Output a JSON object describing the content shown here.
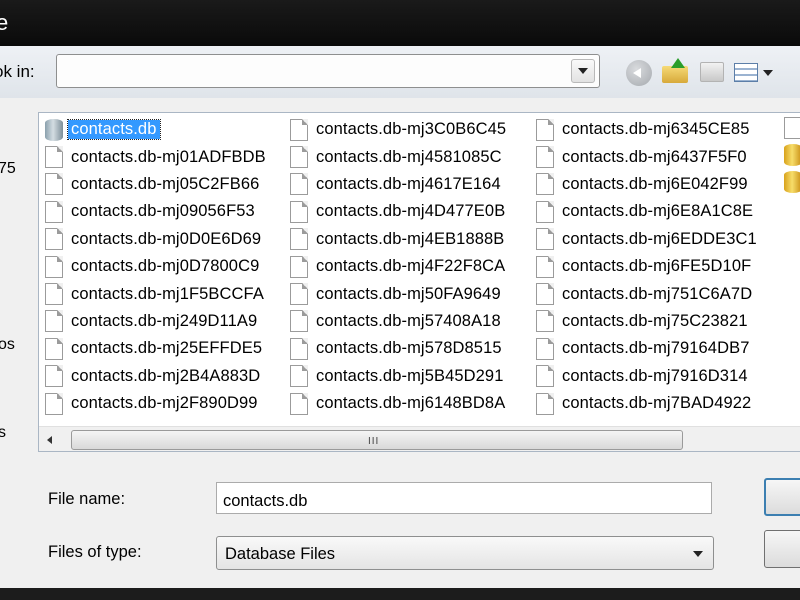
{
  "window": {
    "title_fragment": "e"
  },
  "look_in": {
    "label": "ok in:",
    "value": ""
  },
  "places_fragments": [
    "75",
    "os",
    "s"
  ],
  "files": {
    "columns": [
      [
        {
          "name": "contacts.db",
          "icon": "database",
          "selected": true
        },
        {
          "name": "contacts.db-mj01ADFBDB"
        },
        {
          "name": "contacts.db-mj05C2FB66"
        },
        {
          "name": "contacts.db-mj09056F53"
        },
        {
          "name": "contacts.db-mj0D0E6D69"
        },
        {
          "name": "contacts.db-mj0D7800C9"
        },
        {
          "name": "contacts.db-mj1F5BCCFA"
        },
        {
          "name": "contacts.db-mj249D11A9"
        },
        {
          "name": "contacts.db-mj25EFFDE5"
        },
        {
          "name": "contacts.db-mj2B4A883D"
        },
        {
          "name": "contacts.db-mj2F890D99"
        }
      ],
      [
        {
          "name": "contacts.db-mj3C0B6C45"
        },
        {
          "name": "contacts.db-mj4581085C"
        },
        {
          "name": "contacts.db-mj4617E164"
        },
        {
          "name": "contacts.db-mj4D477E0B"
        },
        {
          "name": "contacts.db-mj4EB1888B"
        },
        {
          "name": "contacts.db-mj4F22F8CA"
        },
        {
          "name": "contacts.db-mj50FA9649"
        },
        {
          "name": "contacts.db-mj57408A18"
        },
        {
          "name": "contacts.db-mj578D8515"
        },
        {
          "name": "contacts.db-mj5B45D291"
        },
        {
          "name": "contacts.db-mj6148BD8A"
        }
      ],
      [
        {
          "name": "contacts.db-mj6345CE85"
        },
        {
          "name": "contacts.db-mj6437F5F0"
        },
        {
          "name": "contacts.db-mj6E042F99"
        },
        {
          "name": "contacts.db-mj6E8A1C8E"
        },
        {
          "name": "contacts.db-mj6EDDE3C1"
        },
        {
          "name": "contacts.db-mj6FE5D10F"
        },
        {
          "name": "contacts.db-mj751C6A7D"
        },
        {
          "name": "contacts.db-mj75C23821"
        },
        {
          "name": "contacts.db-mj79164DB7"
        },
        {
          "name": "contacts.db-mj7916D314"
        },
        {
          "name": "contacts.db-mj7BAD4922"
        }
      ]
    ]
  },
  "scrollbar": {
    "grip": "III"
  },
  "file_name": {
    "label": "File name:",
    "value": "contacts.db"
  },
  "file_type": {
    "label": "Files of type:",
    "value": "Database Files"
  },
  "colors": {
    "selection": "#3399ff",
    "frame": "#0a0a0a",
    "client": "#f0f0f0"
  }
}
